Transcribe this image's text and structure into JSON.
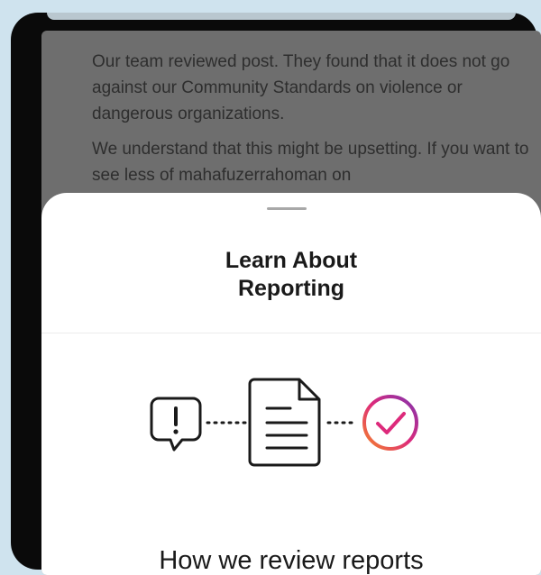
{
  "background_text": {
    "paragraph_1": "Our team reviewed post. They found that it does not go against our Community Standards on violence or dangerous organizations.",
    "paragraph_2": "We understand that this might be upsetting. If you want to see less of mahafuzerrahoman on"
  },
  "sheet": {
    "title": "Learn About\nReporting",
    "section_heading": "How we review reports"
  },
  "icons": {
    "report": "exclamation-speech-bubble-icon",
    "document": "document-icon",
    "reviewed": "checkmark-circle-icon"
  },
  "colors": {
    "check_gradient_start": "#f58529",
    "check_gradient_mid": "#dd2a7b",
    "check_gradient_end": "#8134af"
  }
}
